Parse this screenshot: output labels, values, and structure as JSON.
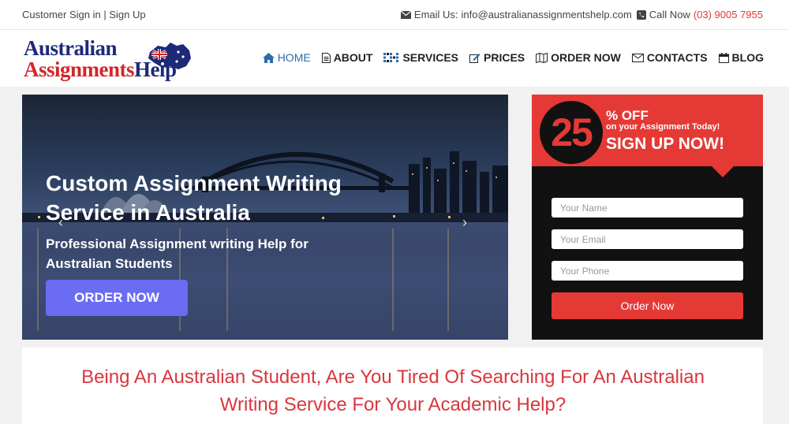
{
  "topbar": {
    "signin": "Customer Sign in",
    "separator": "|",
    "signup": "Sign Up",
    "email_label": "Email Us:",
    "email": "info@australianassignmentshelp.com",
    "call_label": "Call Now",
    "phone": "(03) 9005 7955"
  },
  "logo": {
    "line1": "Australian",
    "line2a": "Assignments",
    "line2b": "Help"
  },
  "nav": [
    {
      "label": "HOME",
      "icon": "home-icon"
    },
    {
      "label": "ABOUT",
      "icon": "document-icon"
    },
    {
      "label": "SERVICES",
      "icon": "grid-icon"
    },
    {
      "label": "PRICES",
      "icon": "edit-icon"
    },
    {
      "label": "ORDER NOW",
      "icon": "map-icon"
    },
    {
      "label": "CONTACTS",
      "icon": "envelope-icon"
    },
    {
      "label": "BLOG",
      "icon": "calendar-icon"
    }
  ],
  "hero": {
    "title": "Custom Assignment Writing Service in Australia",
    "subtitle": "Professional Assignment writing Help for Australian Students",
    "button": "ORDER NOW",
    "prev": "‹",
    "next": "›"
  },
  "signup": {
    "number": "25",
    "percent": "% OFF",
    "line": "on your Assignment Today!",
    "cta": "SIGN UP NOW!",
    "name_placeholder": "Your Name",
    "email_placeholder": "Your Email",
    "phone_placeholder": "Your Phone",
    "button": "Order Now"
  },
  "content": {
    "heading": "Being An Australian Student, Are You Tired Of Searching For An Australian Writing Service For Your Academic Help?"
  },
  "colors": {
    "accent_red": "#e53935",
    "nav_active": "#2a6ca8",
    "hero_button": "#6a6cf4"
  }
}
